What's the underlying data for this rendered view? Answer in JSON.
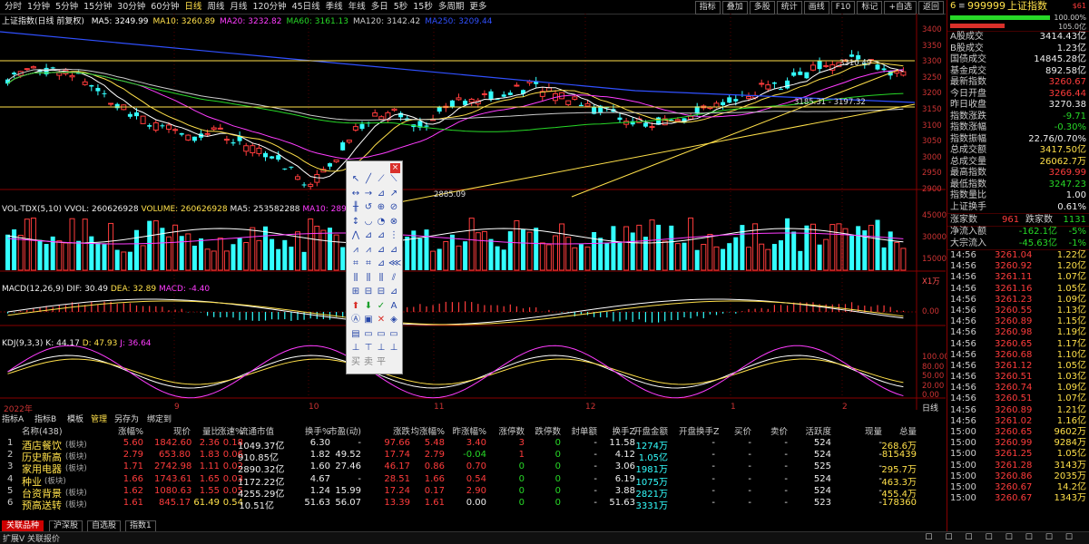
{
  "toolbar": {
    "periods": [
      "分时",
      "1分钟",
      "5分钟",
      "15分钟",
      "30分钟",
      "60分钟",
      "日线",
      "周线",
      "月线",
      "120分钟",
      "45日线",
      "季线",
      "年线",
      "多日",
      "5秒",
      "15秒",
      "多周期",
      "更多"
    ],
    "active_period": "日线",
    "buttons": [
      "指标",
      "叠加",
      "多股",
      "统计",
      "画线",
      "F10",
      "标记",
      "+自选",
      "返回"
    ]
  },
  "main_chart": {
    "title": "上证指数(日线 前复权)",
    "ma": [
      {
        "label": "MA5: 3249.99",
        "color": "#ffffff"
      },
      {
        "label": "MA10: 3260.89",
        "color": "#ffe04a"
      },
      {
        "label": "MA20: 3232.82",
        "color": "#ff3cff"
      },
      {
        "label": "MA60: 3161.13",
        "color": "#27d827"
      },
      {
        "label": "MA120: 3142.42",
        "color": "#cccccc"
      },
      {
        "label": "MA250: 3209.44",
        "color": "#3050ff"
      }
    ],
    "y_ticks": [
      "3400",
      "3350",
      "3300",
      "3250",
      "3200",
      "3150",
      "3100",
      "3050",
      "3000",
      "2950",
      "2900"
    ],
    "annotations": {
      "high": "3310.49",
      "low": "2885.09",
      "range": "3185.31 - 3197.32"
    }
  },
  "vol_panel": {
    "title": "VOL-TDX(5,10)",
    "vvol": "VVOL: 260626928",
    "volume": "VOLUME: 260626928",
    "ma5": "MA5: 253582288",
    "ma10": "MA10: 289766528",
    "y_ticks": [
      "45000",
      "30000",
      "15000"
    ],
    "unit": "X1万"
  },
  "macd_panel": {
    "title": "MACD(12,26,9)",
    "dif": "DIF: 30.49",
    "dea": "DEA: 32.89",
    "macd": "MACD: -4.40",
    "y_ticks": [
      "0.00"
    ]
  },
  "kdj_panel": {
    "title": "KDJ(9,3,3)",
    "k": "K: 44.17",
    "d": "D: 47.93",
    "j": "J: 36.64",
    "y_ticks": [
      "100.00",
      "80.00",
      "50.00",
      "20.00",
      "0.00"
    ]
  },
  "x_axis": {
    "labels": [
      "2022年",
      "9",
      "10",
      "11",
      "12",
      "1",
      "2"
    ],
    "period_label": "日线"
  },
  "list_tabs": [
    "指标A",
    "指标B",
    "模板",
    "管理",
    "另存为",
    "绑定到"
  ],
  "table": {
    "columns": [
      "名称(438)",
      "涨幅%",
      "现价",
      "量比",
      "涨速%",
      "流通市值",
      "换手%",
      "市盈(动)",
      "涨跌",
      "均涨幅%",
      "昨涨幅%",
      "涨停数",
      "跌停数",
      "封单额",
      "换手Z",
      "开盘金额",
      "开盘换手Z",
      "买价",
      "卖价",
      "活跃度",
      "现量",
      "总量"
    ],
    "rows": [
      {
        "no": "1",
        "name": "酒店餐饮",
        "tag": "(板块)",
        "chg": "5.60",
        "price": "1842.60",
        "vr": "2.36",
        "spd": "0.18",
        "mcap": "1049.37亿",
        "to": "6.30",
        "pe": "-",
        "diff": "97.66",
        "avg": "5.48",
        "prev": "3.40",
        "up": "3",
        "down": "0",
        "seal": "-",
        "toz": "11.58",
        "open_amt": "1274万",
        "open_toz": "-",
        "bid": "-",
        "ask": "-",
        "act": "524",
        "cur": "-",
        "vol": "268.6万"
      },
      {
        "no": "2",
        "name": "历史新高",
        "tag": "(板块)",
        "chg": "2.79",
        "price": "653.80",
        "vr": "1.83",
        "spd": "0.06",
        "mcap": "910.85亿",
        "to": "1.82",
        "pe": "49.52",
        "diff": "17.74",
        "avg": "2.79",
        "prev": "-0.04",
        "up": "1",
        "down": "0",
        "seal": "-",
        "toz": "4.12",
        "open_amt": "1.05亿",
        "open_toz": "-",
        "bid": "-",
        "ask": "-",
        "act": "524",
        "cur": "-",
        "vol": "815439"
      },
      {
        "no": "3",
        "name": "家用电器",
        "tag": "(板块)",
        "chg": "1.71",
        "price": "2742.98",
        "vr": "1.11",
        "spd": "0.02",
        "mcap": "2890.32亿",
        "to": "1.60",
        "pe": "27.46",
        "diff": "46.17",
        "avg": "0.86",
        "prev": "0.70",
        "up": "0",
        "down": "0",
        "seal": "-",
        "toz": "3.06",
        "open_amt": "1981万",
        "open_toz": "-",
        "bid": "-",
        "ask": "-",
        "act": "525",
        "cur": "-",
        "vol": "295.7万"
      },
      {
        "no": "4",
        "name": "种业",
        "tag": "(板块)",
        "chg": "1.66",
        "price": "1743.61",
        "vr": "1.65",
        "spd": "0.03",
        "mcap": "1172.22亿",
        "to": "4.67",
        "pe": "-",
        "diff": "28.51",
        "avg": "1.66",
        "prev": "0.54",
        "up": "0",
        "down": "0",
        "seal": "-",
        "toz": "6.19",
        "open_amt": "1075万",
        "open_toz": "-",
        "bid": "-",
        "ask": "-",
        "act": "524",
        "cur": "-",
        "vol": "463.3万"
      },
      {
        "no": "5",
        "name": "台资背景",
        "tag": "(板块)",
        "chg": "1.62",
        "price": "1080.63",
        "vr": "1.55",
        "spd": "0.05",
        "mcap": "4255.29亿",
        "to": "1.24",
        "pe": "15.99",
        "diff": "17.24",
        "avg": "0.17",
        "prev": "2.90",
        "up": "0",
        "down": "0",
        "seal": "-",
        "toz": "3.88",
        "open_amt": "2821万",
        "open_toz": "-",
        "bid": "-",
        "ask": "-",
        "act": "524",
        "cur": "-",
        "vol": "455.4万"
      },
      {
        "no": "6",
        "name": "预高送转",
        "tag": "(板块)",
        "chg": "1.61",
        "price": "845.17",
        "vr": "61.49",
        "spd": "0.54",
        "mcap": "10.51亿",
        "to": "51.63",
        "pe": "56.07",
        "diff": "13.39",
        "avg": "1.61",
        "prev": "0.00",
        "up": "0",
        "down": "0",
        "seal": "-",
        "toz": "51.63",
        "open_amt": "3331万",
        "open_toz": "-",
        "bid": "-",
        "ask": "-",
        "act": "523",
        "cur": "-",
        "vol": "178360"
      }
    ]
  },
  "bottom_tabs": [
    "关联品种",
    "沪深股",
    "自选股",
    "指数1"
  ],
  "status": {
    "left": "扩展V",
    "link": "关联报价"
  },
  "right_panel": {
    "code": "999999",
    "name": "上证指数",
    "prefix": "6",
    "tag": "$61",
    "ratio_top": "100.00%",
    "ratio_bottom": "105.0亿",
    "stats": [
      {
        "k": "A股成交",
        "v": "3414.43亿",
        "c": "white"
      },
      {
        "k": "B股成交",
        "v": "1.23亿",
        "c": "white"
      },
      {
        "k": "国债成交",
        "v": "14845.28亿",
        "c": "white"
      },
      {
        "k": "基金成交",
        "v": "892.58亿",
        "c": "white"
      },
      {
        "k": "最新指数",
        "v": "3260.67",
        "c": "red"
      },
      {
        "k": "今日开盘",
        "v": "3266.44",
        "c": "red"
      },
      {
        "k": "昨日收盘",
        "v": "3270.38",
        "c": "white"
      },
      {
        "k": "指数涨跌",
        "v": "-9.71",
        "c": "green"
      },
      {
        "k": "指数涨幅",
        "v": "-0.30%",
        "c": "green"
      },
      {
        "k": "指数振幅",
        "v": "22.76/0.70%",
        "c": "white"
      },
      {
        "k": "总成交额",
        "v": "3417.50亿",
        "c": "yellow"
      },
      {
        "k": "总成交量",
        "v": "26062.7万",
        "c": "yellow"
      },
      {
        "k": "最高指数",
        "v": "3269.99",
        "c": "red"
      },
      {
        "k": "最低指数",
        "v": "3247.23",
        "c": "green"
      },
      {
        "k": "指数量比",
        "v": "1.00",
        "c": "white"
      },
      {
        "k": "上证换手",
        "v": "0.61%",
        "c": "white"
      }
    ],
    "breadth": {
      "up_label": "涨家数",
      "up": "961",
      "down_label": "跌家数",
      "down": "1131"
    },
    "flows": [
      {
        "k": "净流入额",
        "v": "-162.1亿",
        "p": "-5%"
      },
      {
        "k": "大宗流入",
        "v": "-45.63亿",
        "p": "-1%"
      }
    ],
    "ticks": [
      {
        "t": "14:56",
        "p": "3261.04",
        "c": "1.22亿"
      },
      {
        "t": "14:56",
        "p": "3260.92",
        "c": "1.20亿"
      },
      {
        "t": "14:56",
        "p": "3261.11",
        "c": "1.07亿"
      },
      {
        "t": "14:56",
        "p": "3261.16",
        "c": "1.05亿"
      },
      {
        "t": "14:56",
        "p": "3261.23",
        "c": "1.09亿"
      },
      {
        "t": "14:56",
        "p": "3260.55",
        "c": "1.13亿"
      },
      {
        "t": "14:56",
        "p": "3260.89",
        "c": "1.15亿"
      },
      {
        "t": "14:56",
        "p": "3260.98",
        "c": "1.19亿"
      },
      {
        "t": "14:56",
        "p": "3260.65",
        "c": "1.17亿"
      },
      {
        "t": "14:56",
        "p": "3260.68",
        "c": "1.10亿"
      },
      {
        "t": "14:56",
        "p": "3261.12",
        "c": "1.05亿"
      },
      {
        "t": "14:56",
        "p": "3260.51",
        "c": "1.03亿"
      },
      {
        "t": "14:56",
        "p": "3260.74",
        "c": "1.09亿"
      },
      {
        "t": "14:56",
        "p": "3260.51",
        "c": "1.07亿"
      },
      {
        "t": "14:56",
        "p": "3260.89",
        "c": "1.21亿"
      },
      {
        "t": "14:56",
        "p": "3261.02",
        "c": "1.16亿"
      },
      {
        "t": "15:00",
        "p": "3260.65",
        "c": "9602万"
      },
      {
        "t": "15:00",
        "p": "3260.99",
        "c": "9284万"
      },
      {
        "t": "15:00",
        "p": "3261.25",
        "c": "1.05亿"
      },
      {
        "t": "15:00",
        "p": "3261.28",
        "c": "3143万"
      },
      {
        "t": "15:00",
        "p": "3260.86",
        "c": "2035万"
      },
      {
        "t": "15:00",
        "p": "3260.67",
        "c": "14.2亿"
      },
      {
        "t": "15:00",
        "p": "3260.67",
        "c": "1343万"
      }
    ]
  }
}
